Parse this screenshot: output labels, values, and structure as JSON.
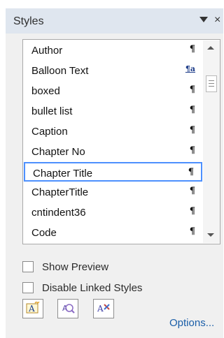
{
  "header": {
    "title": "Styles",
    "close_glyph": "×"
  },
  "styles_list": {
    "items": [
      {
        "label": "Author",
        "mark": "¶",
        "type": "paragraph"
      },
      {
        "label": "Balloon Text",
        "mark": "¶a",
        "type": "linked"
      },
      {
        "label": "boxed",
        "mark": "¶",
        "type": "paragraph"
      },
      {
        "label": "bullet list",
        "mark": "¶",
        "type": "paragraph"
      },
      {
        "label": "Caption",
        "mark": "¶",
        "type": "paragraph"
      },
      {
        "label": "Chapter No",
        "mark": "¶",
        "type": "paragraph"
      },
      {
        "label": "Chapter Title",
        "mark": "¶",
        "type": "paragraph",
        "selected": true
      },
      {
        "label": "ChapterTitle",
        "mark": "¶",
        "type": "paragraph"
      },
      {
        "label": "cntindent36",
        "mark": "¶",
        "type": "paragraph"
      },
      {
        "label": "Code",
        "mark": "¶",
        "type": "paragraph"
      }
    ]
  },
  "options": {
    "show_preview_label": "Show Preview",
    "disable_linked_label": "Disable Linked Styles"
  },
  "footer": {
    "options_link": "Options...",
    "buttons": [
      "new-style-icon",
      "style-inspector-icon",
      "manage-styles-icon"
    ]
  },
  "colors": {
    "header_bg": "#dfe6ef",
    "selection_border": "#4d90fe",
    "link": "#1a5ea8"
  }
}
